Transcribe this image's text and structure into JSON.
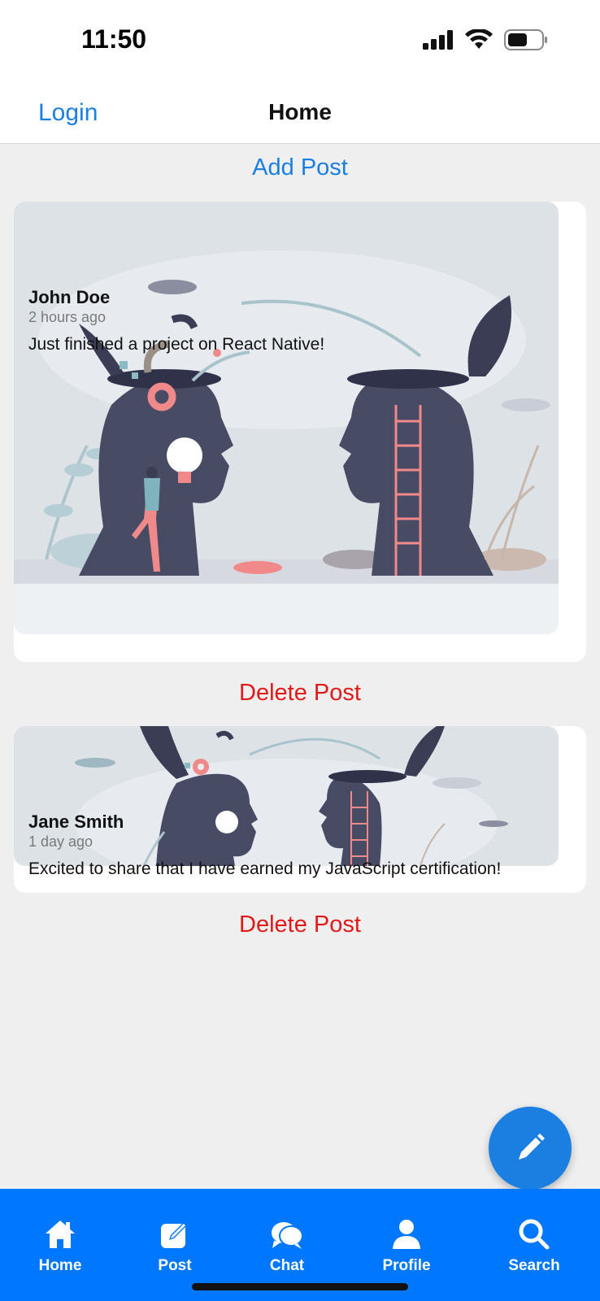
{
  "status_bar": {
    "time": "11:50"
  },
  "nav": {
    "left_label": "Login",
    "title": "Home"
  },
  "actions": {
    "add_post_label": "Add Post"
  },
  "posts": [
    {
      "author": "John Doe",
      "time": "2 hours ago",
      "text": "Just finished a project on React Native!",
      "delete_label": "Delete Post"
    },
    {
      "author": "Jane Smith",
      "time": "1 day ago",
      "text": "Excited to share that I have earned my JavaScript certification!",
      "delete_label": "Delete Post"
    }
  ],
  "fab": {
    "icon": "pencil-icon"
  },
  "tabs": [
    {
      "label": "Home",
      "icon": "home-icon"
    },
    {
      "label": "Post",
      "icon": "edit-post-icon"
    },
    {
      "label": "Chat",
      "icon": "chat-icon"
    },
    {
      "label": "Profile",
      "icon": "profile-icon"
    },
    {
      "label": "Search",
      "icon": "search-icon"
    }
  ],
  "colors": {
    "accent": "#1a7fe0",
    "tab_bar": "#0077ff",
    "danger": "#e01919",
    "background": "#efefef"
  }
}
